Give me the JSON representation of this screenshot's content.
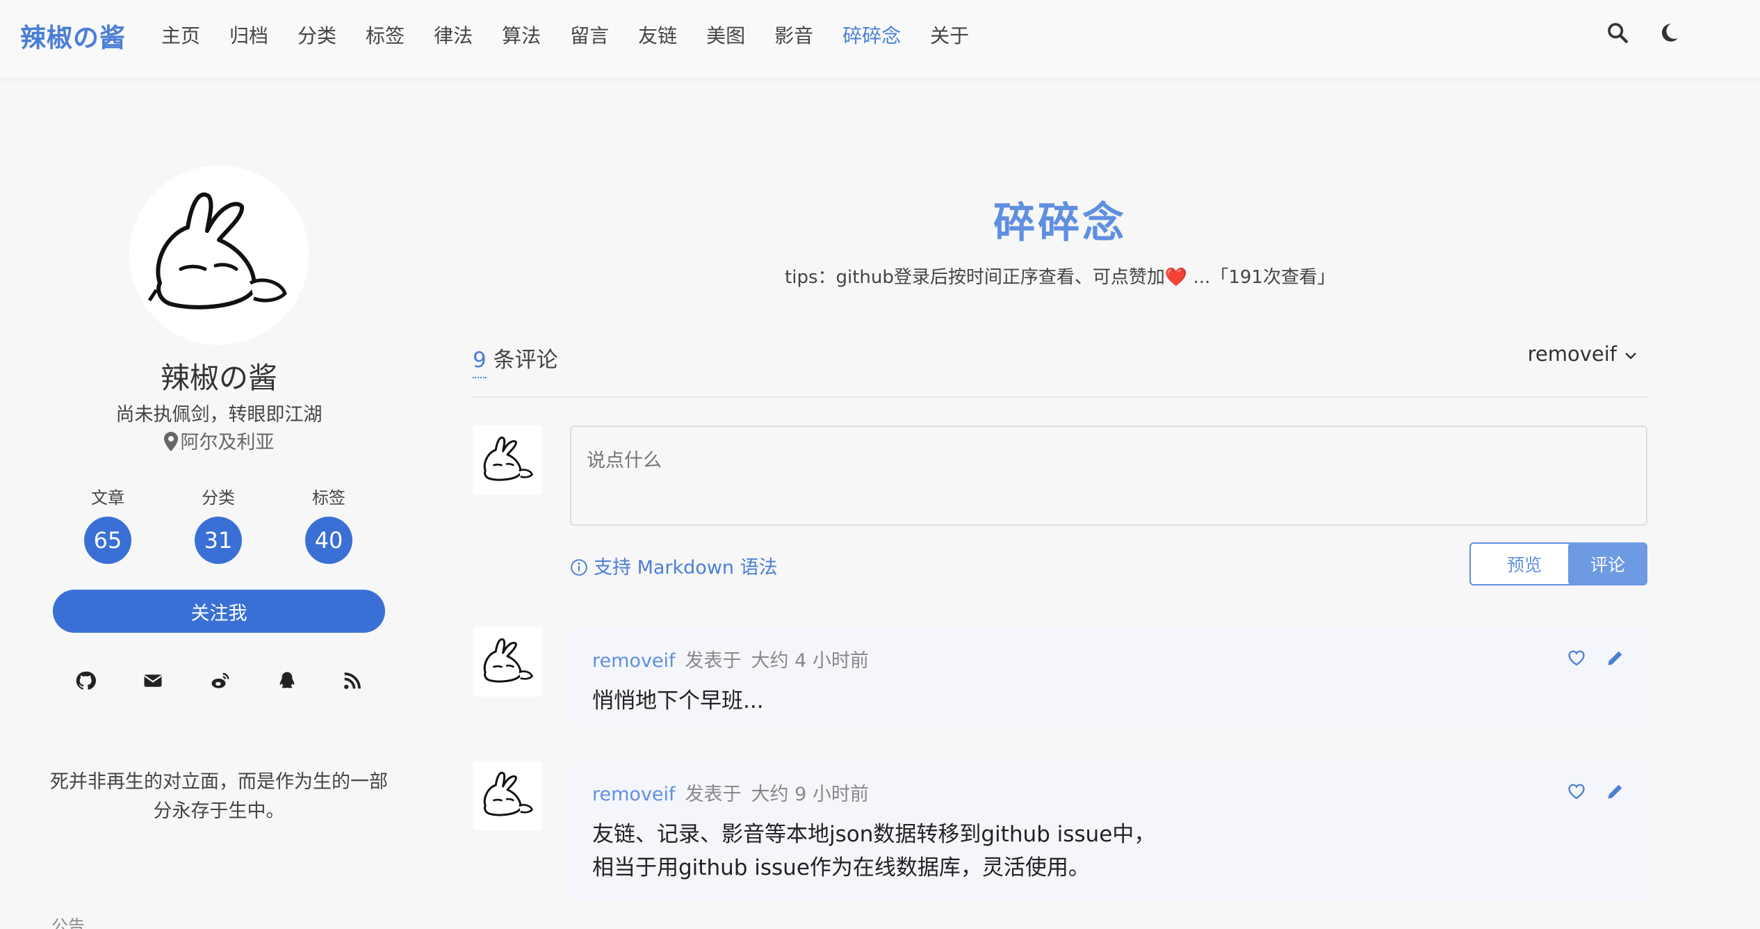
{
  "brand": "辣椒の酱",
  "nav": {
    "items": [
      {
        "label": "主页",
        "active": false
      },
      {
        "label": "归档",
        "active": false
      },
      {
        "label": "分类",
        "active": false
      },
      {
        "label": "标签",
        "active": false
      },
      {
        "label": "律法",
        "active": false
      },
      {
        "label": "算法",
        "active": false
      },
      {
        "label": "留言",
        "active": false
      },
      {
        "label": "友链",
        "active": false
      },
      {
        "label": "美图",
        "active": false
      },
      {
        "label": "影音",
        "active": false
      },
      {
        "label": "碎碎念",
        "active": true
      },
      {
        "label": "关于",
        "active": false
      }
    ],
    "icons": [
      "search-icon",
      "moon-icon"
    ]
  },
  "sidebar": {
    "name": "辣椒の酱",
    "description": "尚未执佩剑，转眼即江湖",
    "location": "阿尔及利亚",
    "stats": [
      {
        "label": "文章",
        "value": "65"
      },
      {
        "label": "分类",
        "value": "31"
      },
      {
        "label": "标签",
        "value": "40"
      }
    ],
    "follow_label": "关注我",
    "socials": [
      "github-icon",
      "email-icon",
      "weibo-icon",
      "qq-icon",
      "rss-icon"
    ],
    "quote": "死并非再生的对立面，而是作为生的一部分永存于生中。",
    "announcement_label": "公告"
  },
  "main": {
    "title": "碎碎念",
    "tips": "tips：github登录后按时间正序查看、可点赞加❤️ ...「191次查看」",
    "comments_count": "9",
    "comments_label": "条评论",
    "current_user": "removeif",
    "editor_placeholder": "说点什么",
    "markdown_tip": "支持 Markdown 语法",
    "preview_label": "预览",
    "submit_label": "评论",
    "comments": [
      {
        "author": "removeif",
        "posted_label": "发表于",
        "time": "大约 4 小时前",
        "lines": [
          "悄悄地下个早班..."
        ]
      },
      {
        "author": "removeif",
        "posted_label": "发表于",
        "time": "大约 9 小时前",
        "lines": [
          "友链、记录、影音等本地json数据转移到github issue中，",
          "相当于用github issue作为在线数据库，灵活使用。"
        ]
      }
    ]
  },
  "colors": {
    "accent": "#4a7fd6",
    "accent_soft": "#5f8fe0",
    "stat_circle": "#3a70d6",
    "card_bg": "#f4f6fb",
    "page_bg": "#f7f7f7"
  }
}
